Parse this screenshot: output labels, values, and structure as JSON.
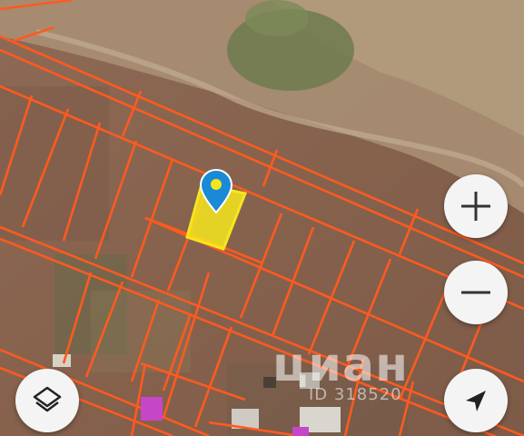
{
  "map": {
    "type": "satellite-cadastral",
    "parcel_line_color": "#ff5a1f",
    "selected_parcel_color": "#f5e61e",
    "pin_color": "#1a8ad6",
    "purple_marker_color": "#c646c8"
  },
  "controls": {
    "zoom_in_icon": "plus-icon",
    "zoom_out_icon": "minus-icon",
    "layers_icon": "layers-icon",
    "locate_icon": "navigation-arrow-icon"
  },
  "watermark": {
    "brand": "циан",
    "code": "ID 318520"
  }
}
